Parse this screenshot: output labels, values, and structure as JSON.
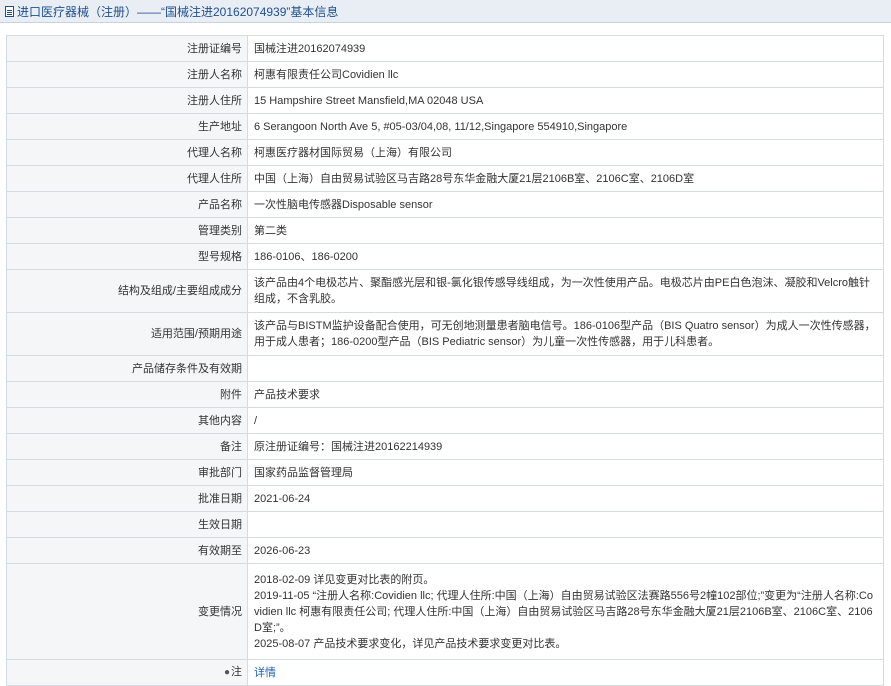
{
  "header": {
    "title": "进口医疗器械（注册）——“国械注进20162074939”基本信息"
  },
  "rows": [
    {
      "label": "注册证编号",
      "value": "国械注进20162074939"
    },
    {
      "label": "注册人名称",
      "value": "柯惠有限责任公司Covidien llc"
    },
    {
      "label": "注册人住所",
      "value": "15 Hampshire Street Mansfield,MA 02048 USA"
    },
    {
      "label": "生产地址",
      "value": "6 Serangoon North Ave 5, #05-03/04,08, 11/12,Singapore 554910,Singapore"
    },
    {
      "label": "代理人名称",
      "value": "柯惠医疗器材国际贸易（上海）有限公司"
    },
    {
      "label": "代理人住所",
      "value": "中国（上海）自由贸易试验区马吉路28号东华金融大厦21层2106B室、2106C室、2106D室"
    },
    {
      "label": "产品名称",
      "value": "一次性脑电传感器Disposable sensor"
    },
    {
      "label": "管理类别",
      "value": "第二类"
    },
    {
      "label": "型号规格",
      "value": "186-0106、186-0200"
    },
    {
      "label": "结构及组成/主要组成成分",
      "value": "该产品由4个电极芯片、聚酯感光层和银-氯化银传感导线组成，为一次性使用产品。电极芯片由PE白色泡沫、凝胶和Velcro触针组成，不含乳胶。"
    },
    {
      "label": "适用范围/预期用途",
      "value": "该产品与BISTM监护设备配合使用，可无创地测量患者脑电信号。186-0106型产品（BIS Quatro sensor）为成人一次性传感器，用于成人患者；186-0200型产品（BIS Pediatric sensor）为儿童一次性传感器，用于儿科患者。"
    },
    {
      "label": "产品储存条件及有效期",
      "value": ""
    },
    {
      "label": "附件",
      "value": "产品技术要求"
    },
    {
      "label": "其他内容",
      "value": "/"
    },
    {
      "label": "备注",
      "value": "原注册证编号：国械注进20162214939"
    },
    {
      "label": "审批部门",
      "value": "国家药品监督管理局"
    },
    {
      "label": "批准日期",
      "value": "2021-06-24"
    },
    {
      "label": "生效日期",
      "value": ""
    },
    {
      "label": "有效期至",
      "value": "2026-06-23"
    }
  ],
  "changes": {
    "label": "变更情况",
    "lines": [
      "2018-02-09 详见变更对比表的附页。",
      "2019-11-05 “注册人名称:Covidien llc; 代理人住所:中国（上海）自由贸易试验区法赛路556号2幢102部位;”变更为“注册人名称:Covidien llc 柯惠有限责任公司; 代理人住所:中国（上海）自由贸易试验区马吉路28号东华金融大厦21层2106B室、2106C室、2106D室;”。",
      "2025-08-07 产品技术要求变化，详见产品技术要求变更对比表。"
    ]
  },
  "note": {
    "icon": "pin-icon",
    "label": "注",
    "link_text": "详情"
  }
}
